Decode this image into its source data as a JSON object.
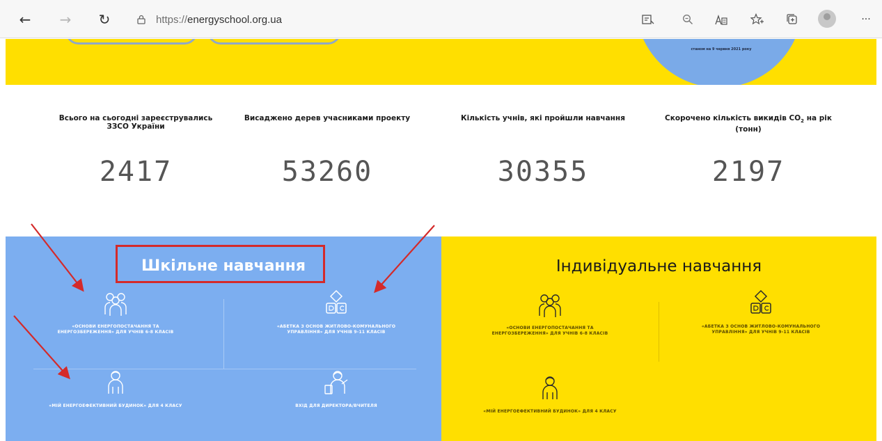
{
  "browser": {
    "url_scheme": "https://",
    "url_host": "energyschool.org.ua",
    "back_icon": "←",
    "forward_icon": "→",
    "reload_icon": "↻",
    "more_icon": "···"
  },
  "hero": {
    "circle_note": "станом на 9 червня 2021 року"
  },
  "stats": [
    {
      "label": "Всього на сьогодні зареєструвались ЗЗСО України",
      "value": "2417"
    },
    {
      "label": "Висаджено дерев учасниками проекту",
      "value": "53260"
    },
    {
      "label": "Кількість учнів, які пройшли навчання",
      "value": "30355"
    },
    {
      "label_pre": "Скорочено кількість викидів CO",
      "label_sub": "2",
      "label_post": " на рік (тонн)",
      "value": "2197"
    }
  ],
  "school": {
    "title": "Шкільне навчання",
    "cards": [
      {
        "text": "«Основи енергопостачання та енергозбереження» для учнів 6-8 класів"
      },
      {
        "text": "«Абетка з основ житлово-комунального управління» для учнів 9-11 класів"
      },
      {
        "text": "«Мій енергоефективний будинок» для 4 класу"
      },
      {
        "text": "Вхід для директора/вчителя"
      }
    ]
  },
  "individual": {
    "title": "Індивідуальне навчання",
    "cards": [
      {
        "text": "«Основи енергопостачання та енергозбереження» для учнів 6-8 класів"
      },
      {
        "text": "«Абетка з основ житлово-комунального управління» для учнів 9-11 класів"
      },
      {
        "text": "«Мій енергоефективний будинок» для 4 класу"
      }
    ]
  },
  "colors": {
    "blue_panel": "#7caef0",
    "yellow": "#ffdf00",
    "annotation_red": "#d42a2a"
  }
}
